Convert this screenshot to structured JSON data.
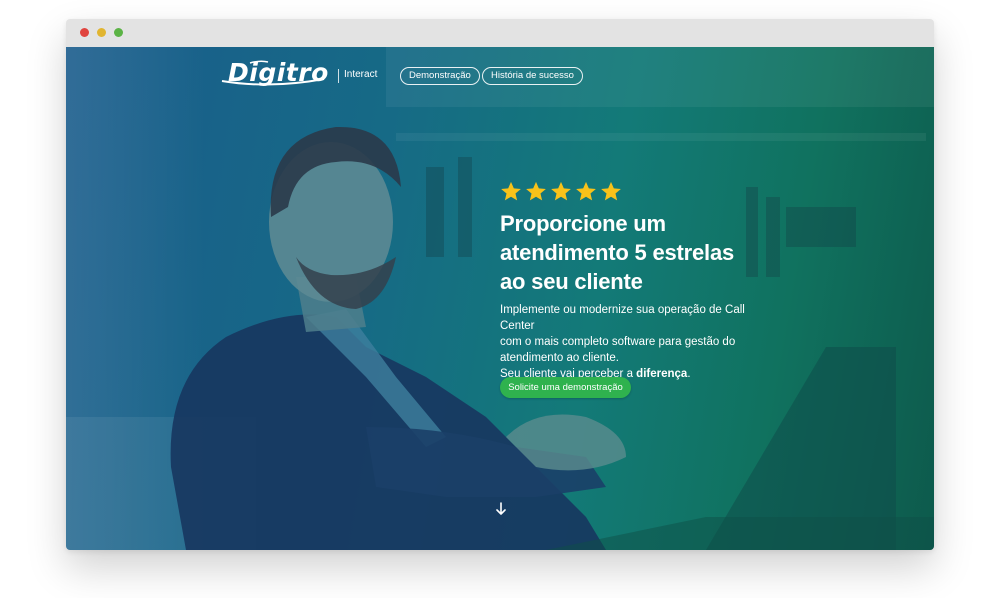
{
  "browser": {
    "buttons": [
      "close",
      "minimize",
      "maximize"
    ]
  },
  "brand": {
    "logo": "Digitro",
    "product": "Interact"
  },
  "nav": {
    "items": [
      {
        "label": "Demonstração"
      },
      {
        "label": "História de sucesso"
      }
    ]
  },
  "hero": {
    "rating": 5,
    "star_color": "#f8c21a",
    "headline_lines": [
      "Proporcione um",
      "atendimento 5 estrelas",
      "ao seu cliente"
    ],
    "paragraph_lines": [
      "Implemente ou modernize sua operação de Call Center",
      "com o mais completo software para gestão do",
      "atendimento ao cliente."
    ],
    "closing_prefix": "Seu cliente vai perceber a ",
    "closing_emphasis": "diferença",
    "closing_suffix": ".",
    "cta_label": "Solicite uma demonstração",
    "cta_color": "#2fb24e",
    "scroll_icon": "arrow-down-icon"
  },
  "colors": {
    "gradient_start": "#1a5c8c",
    "gradient_end": "#0d5a4c"
  }
}
